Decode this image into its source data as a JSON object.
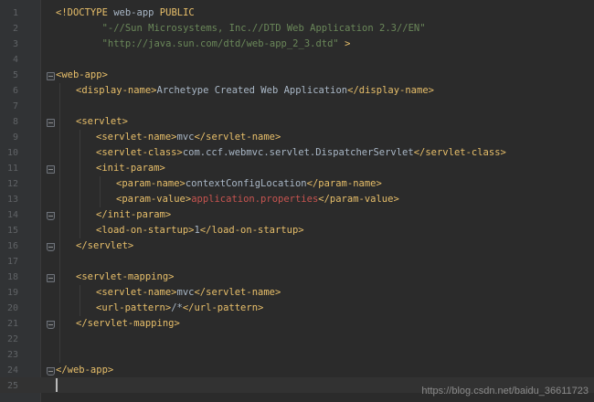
{
  "editor": {
    "lines": [
      {
        "n": "1",
        "indent": 0,
        "fold": "",
        "segs": [
          {
            "t": "<!DOCTYPE ",
            "c": "tag"
          },
          {
            "t": "web-app ",
            "c": "txtc"
          },
          {
            "t": "PUBLIC",
            "c": "tag"
          }
        ]
      },
      {
        "n": "2",
        "indent": 0,
        "fold": "",
        "segs": [
          {
            "t": "        \"-//Sun Microsystems, Inc.//DTD Web Application 2.3//EN\"",
            "c": "str"
          }
        ]
      },
      {
        "n": "3",
        "indent": 0,
        "fold": "",
        "segs": [
          {
            "t": "        \"http://java.sun.com/dtd/web-app_2_3.dtd\" ",
            "c": "str"
          },
          {
            "t": ">",
            "c": "tag"
          }
        ]
      },
      {
        "n": "4",
        "indent": 0,
        "fold": "",
        "segs": []
      },
      {
        "n": "5",
        "indent": 0,
        "fold": "open",
        "segs": [
          {
            "t": "<web-app>",
            "c": "tag"
          }
        ]
      },
      {
        "n": "6",
        "indent": 1,
        "fold": "",
        "segs": [
          {
            "t": "<display-name>",
            "c": "tag"
          },
          {
            "t": "Archetype Created Web Application",
            "c": "txtc"
          },
          {
            "t": "</display-name>",
            "c": "tag"
          }
        ]
      },
      {
        "n": "7",
        "indent": 0,
        "fold": "",
        "segs": []
      },
      {
        "n": "8",
        "indent": 1,
        "fold": "open",
        "segs": [
          {
            "t": "<servlet>",
            "c": "tag"
          }
        ]
      },
      {
        "n": "9",
        "indent": 2,
        "fold": "",
        "segs": [
          {
            "t": "<servlet-name>",
            "c": "tag"
          },
          {
            "t": "mvc",
            "c": "txtc"
          },
          {
            "t": "</servlet-name>",
            "c": "tag"
          }
        ]
      },
      {
        "n": "10",
        "indent": 2,
        "fold": "",
        "segs": [
          {
            "t": "<servlet-class>",
            "c": "tag"
          },
          {
            "t": "com.ccf.webmvc.servlet.DispatcherServlet",
            "c": "txtc"
          },
          {
            "t": "</servlet-class>",
            "c": "tag"
          }
        ]
      },
      {
        "n": "11",
        "indent": 2,
        "fold": "open",
        "segs": [
          {
            "t": "<init-param>",
            "c": "tag"
          }
        ]
      },
      {
        "n": "12",
        "indent": 3,
        "fold": "",
        "segs": [
          {
            "t": "<param-name>",
            "c": "tag"
          },
          {
            "t": "contextConfigLocation",
            "c": "txtc"
          },
          {
            "t": "</param-name>",
            "c": "tag"
          }
        ]
      },
      {
        "n": "13",
        "indent": 3,
        "fold": "",
        "segs": [
          {
            "t": "<param-value>",
            "c": "tag"
          },
          {
            "t": "application.properties",
            "c": "red"
          },
          {
            "t": "</param-value>",
            "c": "tag"
          }
        ]
      },
      {
        "n": "14",
        "indent": 2,
        "fold": "end",
        "segs": [
          {
            "t": "</init-param>",
            "c": "tag"
          }
        ]
      },
      {
        "n": "15",
        "indent": 2,
        "fold": "",
        "segs": [
          {
            "t": "<load-on-startup>",
            "c": "tag"
          },
          {
            "t": "1",
            "c": "txtc"
          },
          {
            "t": "</load-on-startup>",
            "c": "tag"
          }
        ]
      },
      {
        "n": "16",
        "indent": 1,
        "fold": "end",
        "segs": [
          {
            "t": "</servlet>",
            "c": "tag"
          }
        ]
      },
      {
        "n": "17",
        "indent": 0,
        "fold": "",
        "segs": []
      },
      {
        "n": "18",
        "indent": 1,
        "fold": "open",
        "segs": [
          {
            "t": "<servlet-mapping>",
            "c": "tag"
          }
        ]
      },
      {
        "n": "19",
        "indent": 2,
        "fold": "",
        "segs": [
          {
            "t": "<servlet-name>",
            "c": "tag"
          },
          {
            "t": "mvc",
            "c": "txtc"
          },
          {
            "t": "</servlet-name>",
            "c": "tag"
          }
        ]
      },
      {
        "n": "20",
        "indent": 2,
        "fold": "",
        "segs": [
          {
            "t": "<url-pattern>",
            "c": "tag"
          },
          {
            "t": "/*",
            "c": "txtc"
          },
          {
            "t": "</url-pattern>",
            "c": "tag"
          }
        ]
      },
      {
        "n": "21",
        "indent": 1,
        "fold": "end",
        "segs": [
          {
            "t": "</servlet-mapping>",
            "c": "tag"
          }
        ]
      },
      {
        "n": "22",
        "indent": 0,
        "fold": "",
        "segs": []
      },
      {
        "n": "23",
        "indent": 0,
        "fold": "",
        "segs": []
      },
      {
        "n": "24",
        "indent": 0,
        "fold": "end",
        "segs": [
          {
            "t": "</web-app>",
            "c": "tag"
          }
        ]
      },
      {
        "n": "25",
        "indent": 0,
        "fold": "",
        "segs": []
      }
    ],
    "colors": {
      "background": "#2b2b2b",
      "gutter": "#313335",
      "tag": "#e8bf6a",
      "string": "#6a8759",
      "text": "#a9b7c6",
      "unresolved": "#c75450"
    }
  },
  "watermark": {
    "text": "https://blog.csdn.net/baidu_36611723"
  }
}
